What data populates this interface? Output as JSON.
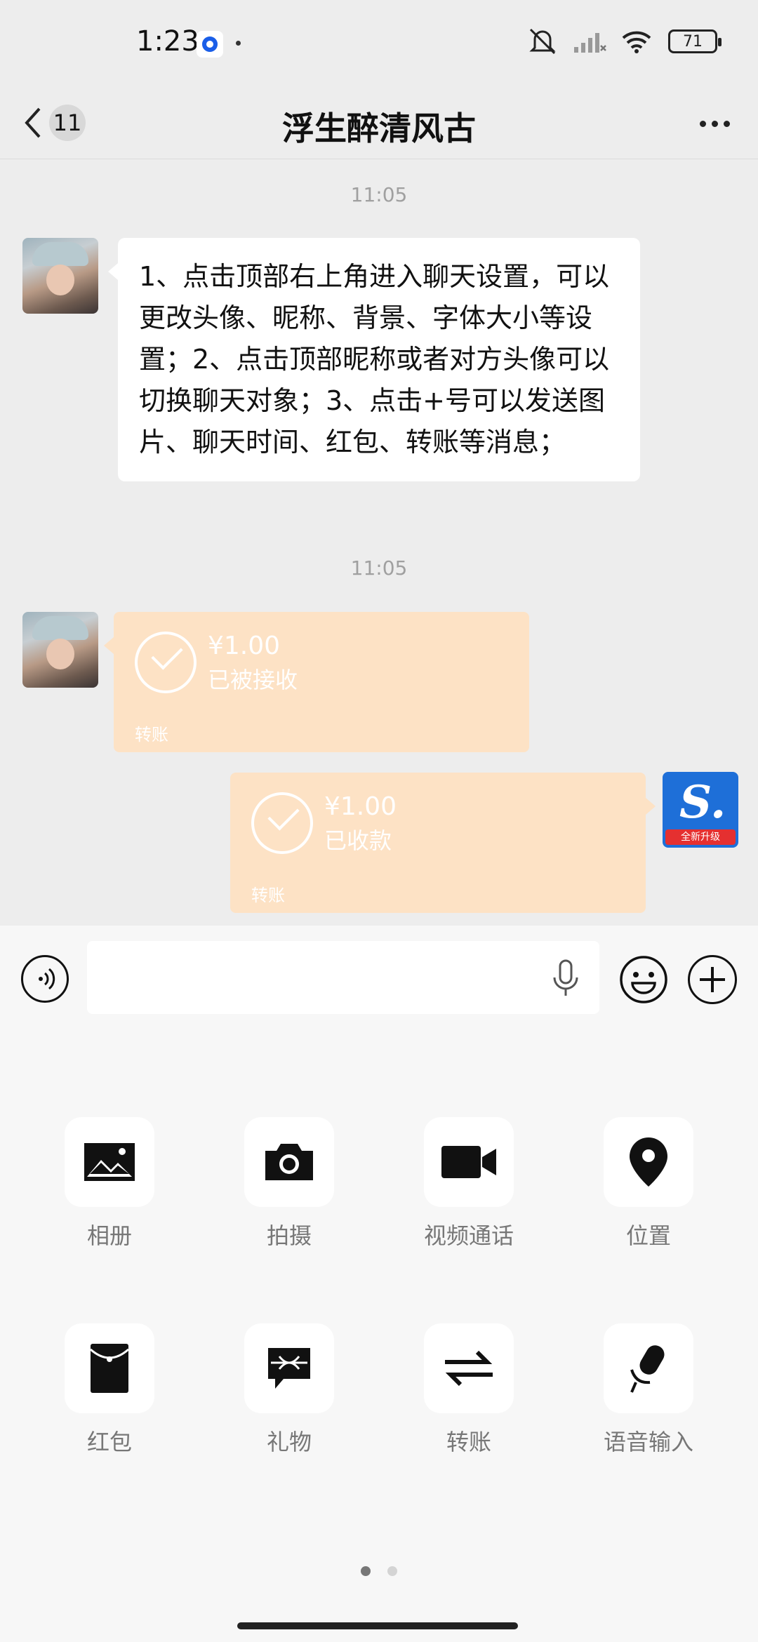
{
  "status_bar": {
    "time": "1:23",
    "battery": "71"
  },
  "nav": {
    "back_badge": "11",
    "title": "浮生醉清风古"
  },
  "chat": {
    "messages": [
      {
        "timestamp": "11:05",
        "text": "1、点击顶部右上角进入聊天设置，可以更改头像、昵称、背景、字体大小等设置；2、点击顶部昵称或者对方头像可以切换聊天对象；3、点击+号可以发送图片、聊天时间、红包、转账等消息；"
      },
      {
        "timestamp": "11:05"
      }
    ],
    "transfer_received": {
      "amount": "¥1.00",
      "status": "已被接收",
      "label": "转账"
    },
    "transfer_sent": {
      "amount": "¥1.00",
      "status": "已收款",
      "label": "转账"
    },
    "app_avatar_banner": "全新升级"
  },
  "input": {
    "placeholder": ""
  },
  "panel": {
    "functions": [
      {
        "label": "相册",
        "icon": "photo-album-icon"
      },
      {
        "label": "拍摄",
        "icon": "camera-icon"
      },
      {
        "label": "视频通话",
        "icon": "video-call-icon"
      },
      {
        "label": "位置",
        "icon": "location-icon"
      },
      {
        "label": "红包",
        "icon": "red-packet-icon"
      },
      {
        "label": "礼物",
        "icon": "gift-icon"
      },
      {
        "label": "转账",
        "icon": "transfer-icon"
      },
      {
        "label": "语音输入",
        "icon": "voice-input-icon"
      }
    ],
    "page_count": 2,
    "active_page": 1
  },
  "colors": {
    "background": "#ededed",
    "transfer_bubble": "#fde2c5",
    "panel": "#f7f7f7"
  }
}
